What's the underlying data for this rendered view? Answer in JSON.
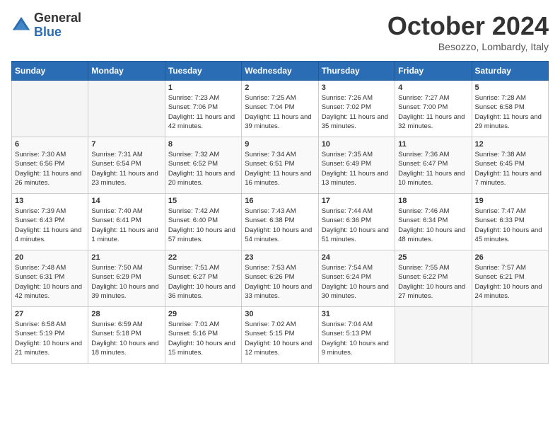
{
  "header": {
    "logo_general": "General",
    "logo_blue": "Blue",
    "month_title": "October 2024",
    "location": "Besozzo, Lombardy, Italy"
  },
  "days_of_week": [
    "Sunday",
    "Monday",
    "Tuesday",
    "Wednesday",
    "Thursday",
    "Friday",
    "Saturday"
  ],
  "weeks": [
    {
      "days": [
        {
          "num": "",
          "info": "",
          "empty": true
        },
        {
          "num": "",
          "info": "",
          "empty": true
        },
        {
          "num": "1",
          "info": "Sunrise: 7:23 AM\nSunset: 7:06 PM\nDaylight: 11 hours and 42 minutes."
        },
        {
          "num": "2",
          "info": "Sunrise: 7:25 AM\nSunset: 7:04 PM\nDaylight: 11 hours and 39 minutes."
        },
        {
          "num": "3",
          "info": "Sunrise: 7:26 AM\nSunset: 7:02 PM\nDaylight: 11 hours and 35 minutes."
        },
        {
          "num": "4",
          "info": "Sunrise: 7:27 AM\nSunset: 7:00 PM\nDaylight: 11 hours and 32 minutes."
        },
        {
          "num": "5",
          "info": "Sunrise: 7:28 AM\nSunset: 6:58 PM\nDaylight: 11 hours and 29 minutes."
        }
      ]
    },
    {
      "days": [
        {
          "num": "6",
          "info": "Sunrise: 7:30 AM\nSunset: 6:56 PM\nDaylight: 11 hours and 26 minutes."
        },
        {
          "num": "7",
          "info": "Sunrise: 7:31 AM\nSunset: 6:54 PM\nDaylight: 11 hours and 23 minutes."
        },
        {
          "num": "8",
          "info": "Sunrise: 7:32 AM\nSunset: 6:52 PM\nDaylight: 11 hours and 20 minutes."
        },
        {
          "num": "9",
          "info": "Sunrise: 7:34 AM\nSunset: 6:51 PM\nDaylight: 11 hours and 16 minutes."
        },
        {
          "num": "10",
          "info": "Sunrise: 7:35 AM\nSunset: 6:49 PM\nDaylight: 11 hours and 13 minutes."
        },
        {
          "num": "11",
          "info": "Sunrise: 7:36 AM\nSunset: 6:47 PM\nDaylight: 11 hours and 10 minutes."
        },
        {
          "num": "12",
          "info": "Sunrise: 7:38 AM\nSunset: 6:45 PM\nDaylight: 11 hours and 7 minutes."
        }
      ]
    },
    {
      "days": [
        {
          "num": "13",
          "info": "Sunrise: 7:39 AM\nSunset: 6:43 PM\nDaylight: 11 hours and 4 minutes."
        },
        {
          "num": "14",
          "info": "Sunrise: 7:40 AM\nSunset: 6:41 PM\nDaylight: 11 hours and 1 minute."
        },
        {
          "num": "15",
          "info": "Sunrise: 7:42 AM\nSunset: 6:40 PM\nDaylight: 10 hours and 57 minutes."
        },
        {
          "num": "16",
          "info": "Sunrise: 7:43 AM\nSunset: 6:38 PM\nDaylight: 10 hours and 54 minutes."
        },
        {
          "num": "17",
          "info": "Sunrise: 7:44 AM\nSunset: 6:36 PM\nDaylight: 10 hours and 51 minutes."
        },
        {
          "num": "18",
          "info": "Sunrise: 7:46 AM\nSunset: 6:34 PM\nDaylight: 10 hours and 48 minutes."
        },
        {
          "num": "19",
          "info": "Sunrise: 7:47 AM\nSunset: 6:33 PM\nDaylight: 10 hours and 45 minutes."
        }
      ]
    },
    {
      "days": [
        {
          "num": "20",
          "info": "Sunrise: 7:48 AM\nSunset: 6:31 PM\nDaylight: 10 hours and 42 minutes."
        },
        {
          "num": "21",
          "info": "Sunrise: 7:50 AM\nSunset: 6:29 PM\nDaylight: 10 hours and 39 minutes."
        },
        {
          "num": "22",
          "info": "Sunrise: 7:51 AM\nSunset: 6:27 PM\nDaylight: 10 hours and 36 minutes."
        },
        {
          "num": "23",
          "info": "Sunrise: 7:53 AM\nSunset: 6:26 PM\nDaylight: 10 hours and 33 minutes."
        },
        {
          "num": "24",
          "info": "Sunrise: 7:54 AM\nSunset: 6:24 PM\nDaylight: 10 hours and 30 minutes."
        },
        {
          "num": "25",
          "info": "Sunrise: 7:55 AM\nSunset: 6:22 PM\nDaylight: 10 hours and 27 minutes."
        },
        {
          "num": "26",
          "info": "Sunrise: 7:57 AM\nSunset: 6:21 PM\nDaylight: 10 hours and 24 minutes."
        }
      ]
    },
    {
      "days": [
        {
          "num": "27",
          "info": "Sunrise: 6:58 AM\nSunset: 5:19 PM\nDaylight: 10 hours and 21 minutes."
        },
        {
          "num": "28",
          "info": "Sunrise: 6:59 AM\nSunset: 5:18 PM\nDaylight: 10 hours and 18 minutes."
        },
        {
          "num": "29",
          "info": "Sunrise: 7:01 AM\nSunset: 5:16 PM\nDaylight: 10 hours and 15 minutes."
        },
        {
          "num": "30",
          "info": "Sunrise: 7:02 AM\nSunset: 5:15 PM\nDaylight: 10 hours and 12 minutes."
        },
        {
          "num": "31",
          "info": "Sunrise: 7:04 AM\nSunset: 5:13 PM\nDaylight: 10 hours and 9 minutes."
        },
        {
          "num": "",
          "info": "",
          "empty": true
        },
        {
          "num": "",
          "info": "",
          "empty": true
        }
      ]
    }
  ]
}
